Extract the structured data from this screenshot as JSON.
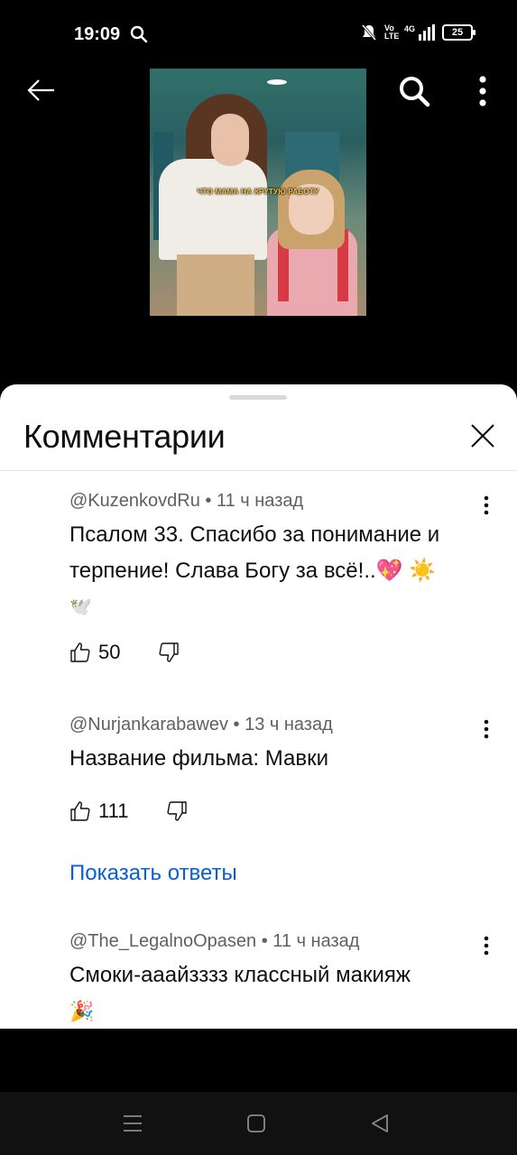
{
  "status_bar": {
    "time": "19:09",
    "network": "4G",
    "volte": "Vo LTE",
    "battery": "25",
    "icons": [
      "search-icon",
      "mute-icon",
      "volte-icon",
      "signal-icon",
      "battery-icon"
    ]
  },
  "player": {
    "caption": "ЧТО МАМА НА КРУТУЮ РАБОТУ",
    "icons": [
      "back-arrow-icon",
      "search-icon",
      "more-vert-icon"
    ]
  },
  "comments": {
    "title": "Комментарии",
    "items": [
      {
        "author": "@KuzenkovdRu",
        "time": "11 ч назад",
        "text_line1": "Псалом 33. Спасибо за понимание и",
        "text_line2": "терпение! Слава Богу за всё!..",
        "emoji_line2": "💖 ☀️",
        "emoji_line3": "🕊️",
        "likes": "50"
      },
      {
        "author": "@Nurjankarabawev",
        "time": "13 ч назад",
        "text_line1": "Название фильма: Мавки",
        "likes": "111"
      },
      {
        "author": "@The_LegalnoOpasen",
        "time": "11 ч назад",
        "text_line1": "Смоки-ааайзззз классный макияж",
        "emoji_line2": "🎉"
      }
    ],
    "show_replies": "Показать ответы",
    "separator": "•"
  },
  "colors": {
    "link": "#065fd4",
    "meta": "#606060",
    "text": "#0f0f0f"
  }
}
